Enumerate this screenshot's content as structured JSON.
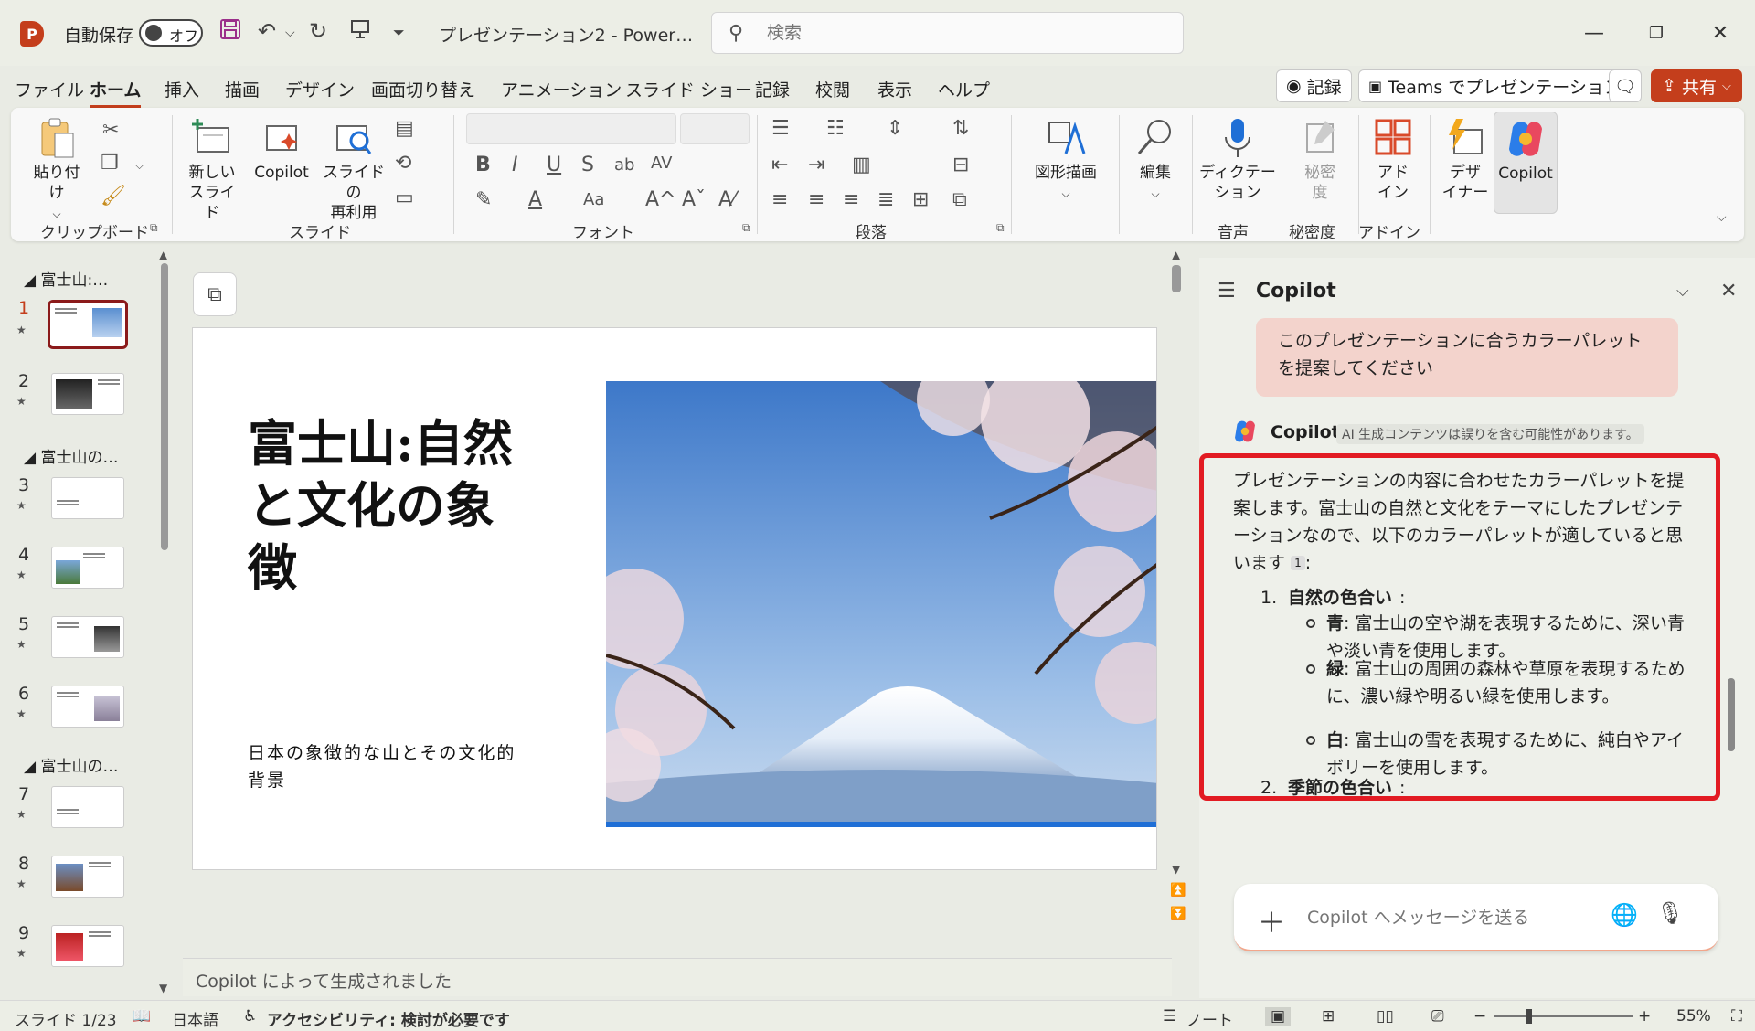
{
  "titlebar": {
    "app_letter": "P",
    "autosave_label": "自動保存",
    "autosave_state": "オフ",
    "doc_title": "プレゼンテーション2  -  Power…",
    "search_placeholder": "検索"
  },
  "menu": {
    "tabs": [
      "ファイル",
      "ホーム",
      "挿入",
      "描画",
      "デザイン",
      "画面切り替え",
      "アニメーション",
      "スライド ショー",
      "記録",
      "校閲",
      "表示",
      "ヘルプ"
    ],
    "active_tab": "ホーム",
    "record_label": "記録",
    "teams_label": "Teams でプレゼンテーション",
    "share_label": "共有"
  },
  "ribbon": {
    "clipboard": {
      "paste_label": "貼り付け",
      "group_label": "クリップボード"
    },
    "slides": {
      "new_slide_label": "新しい\nスライド",
      "copilot_label": "Copilot",
      "reuse_label": "スライドの\n再利用",
      "group_label": "スライド"
    },
    "font": {
      "group_label": "フォント",
      "bold": "B",
      "italic": "I",
      "underline": "U",
      "strike": "S"
    },
    "paragraph": {
      "group_label": "段落"
    },
    "drawing": {
      "label": "図形描画"
    },
    "editing": {
      "label": "編集"
    },
    "voice": {
      "dictate_label": "ディクテー\nション",
      "group_label": "音声"
    },
    "sensitivity": {
      "label": "秘密\n度",
      "group_label": "秘密度"
    },
    "addins": {
      "label": "アド\nイン",
      "group_label": "アドイン"
    },
    "designer": {
      "label": "デザ\nイナー"
    },
    "copilot": {
      "label": "Copilot"
    }
  },
  "thumbnails": {
    "sections": [
      "富士山:…",
      "富士山の…",
      "富士山の…"
    ],
    "slides": [
      "1",
      "2",
      "3",
      "4",
      "5",
      "6",
      "7",
      "8",
      "9"
    ],
    "active_slide": "1"
  },
  "slide": {
    "title": "富士山:自然と文化の象徴",
    "subtitle": "日本の象徴的な山とその文化的背景",
    "notes": "Copilot によって生成されました"
  },
  "copilot_pane": {
    "title": "Copilot",
    "user_message": "このプレゼンテーションに合うカラーパレットを提案してください",
    "assistant_name": "Copilot",
    "disclaimer": "AI 生成コンテンツは誤りを含む可能性があります。",
    "intro": "プレゼンテーションの内容に合わせたカラーパレットを提案します。富士山の自然と文化をテーマにしたプレゼンテーションなので、以下のカラーパレットが適していると思います",
    "ref": "1",
    "items": [
      {
        "num": "1.",
        "heading": "自然の色合い",
        "subitems": [
          {
            "label": "青",
            "text": ": 富士山の空や湖を表現するために、深い青や淡い青を使用します。"
          },
          {
            "label": "緑",
            "text": ": 富士山の周囲の森林や草原を表現するために、濃い緑や明るい緑を使用します。"
          },
          {
            "label": "白",
            "text": ": 富士山の雪を表現するために、純白やアイボリーを使用します。"
          }
        ]
      },
      {
        "num": "2.",
        "heading": "季節の色合い",
        "subitems": []
      }
    ],
    "input_placeholder": "Copilot へメッセージを送る"
  },
  "statusbar": {
    "slide_info": "スライド 1/23",
    "language": "日本語",
    "accessibility": "アクセシビリティ: 検討が必要です",
    "notes_label": "ノート",
    "zoom": "55%"
  },
  "colors": {
    "accent": "#c43e1c",
    "highlight_border": "#e21b23",
    "user_bubble": "#f3d3cc",
    "slide_blue_bar": "#1f6fd6"
  }
}
